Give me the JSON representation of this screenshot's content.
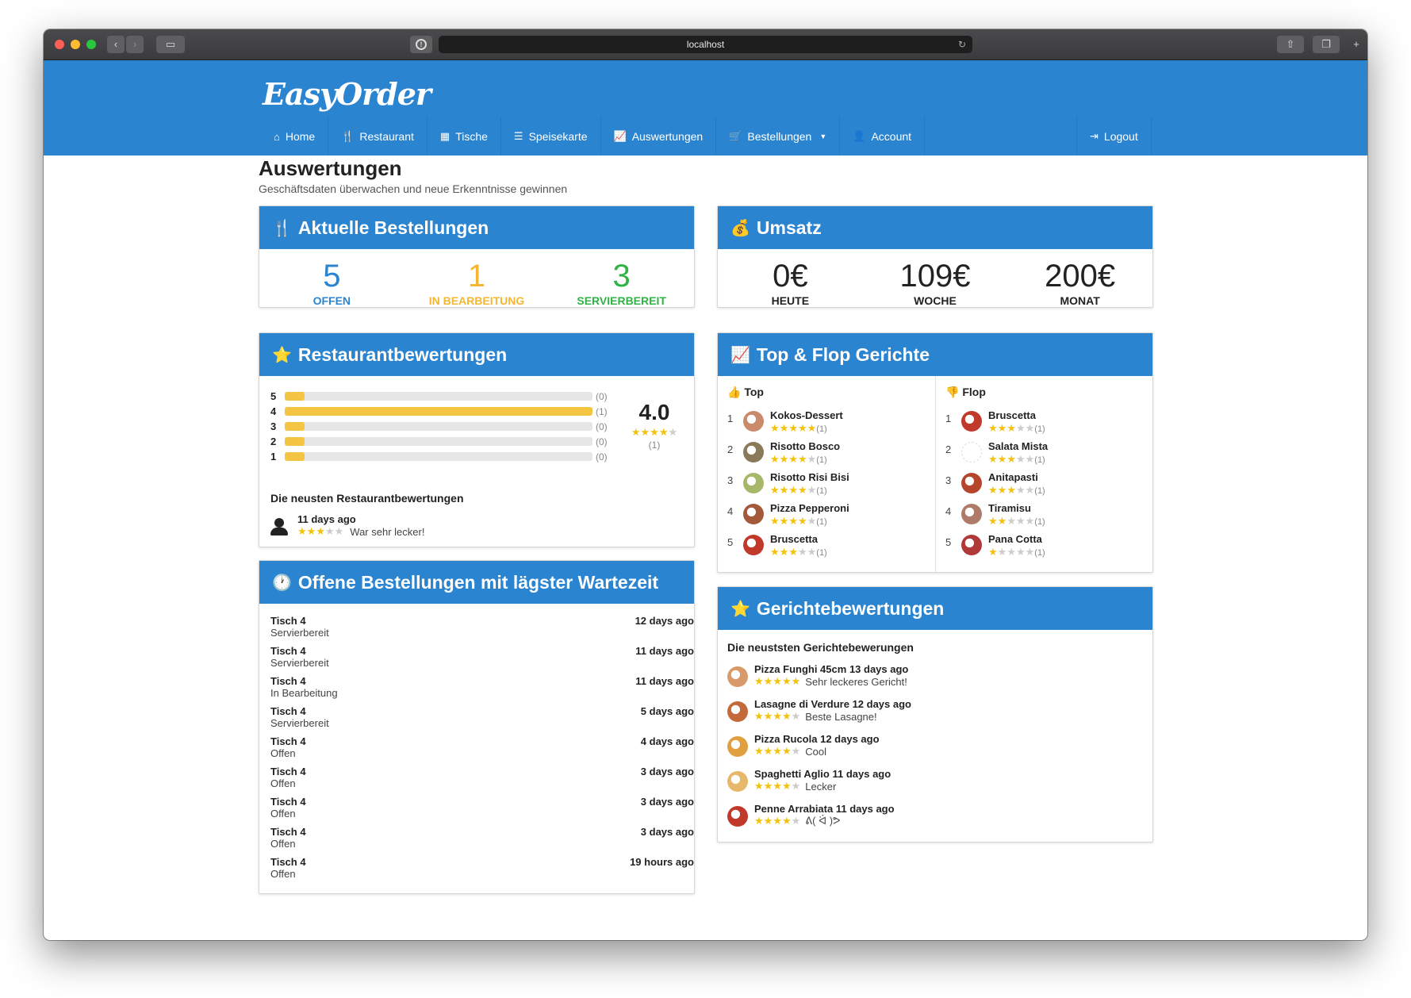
{
  "browser": {
    "url": "localhost"
  },
  "app": {
    "brand": "EasyOrder"
  },
  "nav": {
    "items": [
      {
        "label": "Home",
        "icon": "home-icon",
        "glyph": "⌂"
      },
      {
        "label": "Restaurant",
        "icon": "cutlery-icon",
        "glyph": "🍴"
      },
      {
        "label": "Tische",
        "icon": "grid-icon",
        "glyph": "▦"
      },
      {
        "label": "Speisekarte",
        "icon": "list-icon",
        "glyph": "☰"
      },
      {
        "label": "Auswertungen",
        "icon": "chart-icon",
        "glyph": "📈"
      },
      {
        "label": "Bestellungen",
        "icon": "cart-icon",
        "glyph": "🛒",
        "dropdown": true
      },
      {
        "label": "Account",
        "icon": "user-icon",
        "glyph": "👤"
      }
    ],
    "logout": {
      "label": "Logout",
      "icon": "logout-icon",
      "glyph": "⇥"
    }
  },
  "page": {
    "title": "Auswertungen",
    "subtitle": "Geschäftsdaten überwachen und neue Erkenntnisse gewinnen"
  },
  "orders": {
    "title": "Aktuelle Bestellungen",
    "icon": "🍴",
    "stats": [
      {
        "value": "5",
        "label": "OFFEN",
        "color": "#2a84d0"
      },
      {
        "value": "1",
        "label": "IN BEARBEITUNG",
        "color": "#f5b731"
      },
      {
        "value": "3",
        "label": "SERVIERBEREIT",
        "color": "#2fb344"
      }
    ]
  },
  "revenue": {
    "title": "Umsatz",
    "icon": "💰",
    "stats": [
      {
        "value": "0€",
        "label": "HEUTE"
      },
      {
        "value": "109€",
        "label": "WOCHE"
      },
      {
        "value": "200€",
        "label": "MONAT"
      }
    ]
  },
  "ratings": {
    "title": "Restaurantbewertungen",
    "icon": "⭐",
    "rows": [
      {
        "stars": "5",
        "count": "(0)",
        "fraction": 0.065
      },
      {
        "stars": "4",
        "count": "(1)",
        "fraction": 1.0
      },
      {
        "stars": "3",
        "count": "(0)",
        "fraction": 0.065
      },
      {
        "stars": "2",
        "count": "(0)",
        "fraction": 0.065
      },
      {
        "stars": "1",
        "count": "(0)",
        "fraction": 0.065
      }
    ],
    "average": "4.0",
    "average_stars": 4,
    "total": "(1)",
    "newest_title": "Die neusten Restaurantbewertungen",
    "newest": [
      {
        "when": "11 days ago",
        "stars": 3,
        "text": "War sehr lecker!"
      }
    ]
  },
  "waiting": {
    "title": "Offene Bestellungen mit lägster Wartezeit",
    "icon": "🕐",
    "rows": [
      {
        "table": "Tisch 4",
        "status": "Servierbereit",
        "ago": "12 days ago"
      },
      {
        "table": "Tisch 4",
        "status": "Servierbereit",
        "ago": "11 days ago"
      },
      {
        "table": "Tisch 4",
        "status": "In Bearbeitung",
        "ago": "11 days ago"
      },
      {
        "table": "Tisch 4",
        "status": "Servierbereit",
        "ago": "5 days ago"
      },
      {
        "table": "Tisch 4",
        "status": "Offen",
        "ago": "4 days ago"
      },
      {
        "table": "Tisch 4",
        "status": "Offen",
        "ago": "3 days ago"
      },
      {
        "table": "Tisch 4",
        "status": "Offen",
        "ago": "3 days ago"
      },
      {
        "table": "Tisch 4",
        "status": "Offen",
        "ago": "3 days ago"
      },
      {
        "table": "Tisch 4",
        "status": "Offen",
        "ago": "19 hours ago"
      }
    ]
  },
  "topflop": {
    "title": "Top & Flop Gerichte",
    "icon": "📈",
    "top": {
      "title": "Top",
      "icon": "👍",
      "items": [
        {
          "rank": "1",
          "name": "Kokos-Dessert",
          "stars": 5,
          "count": "(1)",
          "color": "#c98b6b"
        },
        {
          "rank": "2",
          "name": "Risotto Bosco",
          "stars": 4,
          "count": "(1)",
          "color": "#8a7a5a"
        },
        {
          "rank": "3",
          "name": "Risotto Risi Bisi",
          "stars": 4,
          "count": "(1)",
          "color": "#a8b86a"
        },
        {
          "rank": "4",
          "name": "Pizza Pepperoni",
          "stars": 4,
          "count": "(1)",
          "color": "#a45a3a"
        },
        {
          "rank": "5",
          "name": "Bruscetta",
          "stars": 3,
          "count": "(1)",
          "color": "#c0392b"
        }
      ]
    },
    "flop": {
      "title": "Flop",
      "icon": "👎",
      "items": [
        {
          "rank": "1",
          "name": "Bruscetta",
          "stars": 3,
          "count": "(1)",
          "color": "#c0392b"
        },
        {
          "rank": "2",
          "name": "Salata Mista",
          "stars": 3,
          "count": "(1)",
          "color": "#ffffff"
        },
        {
          "rank": "3",
          "name": "Anitapasti",
          "stars": 3,
          "count": "(1)",
          "color": "#b5452b"
        },
        {
          "rank": "4",
          "name": "Tiramisu",
          "stars": 2,
          "count": "(1)",
          "color": "#b07a6a"
        },
        {
          "rank": "5",
          "name": "Pana Cotta",
          "stars": 1,
          "count": "(1)",
          "color": "#b03a3a"
        }
      ]
    }
  },
  "dish_reviews": {
    "title": "Gerichtebewertungen",
    "icon": "⭐",
    "subtitle": "Die neuststen Gerichtebewerungen",
    "items": [
      {
        "dish": "Pizza Funghi 45cm",
        "when": "13 days ago",
        "stars": 5,
        "text": "Sehr leckeres Gericht!",
        "color": "#d89a6a"
      },
      {
        "dish": "Lasagne di Verdure",
        "when": "12 days ago",
        "stars": 4,
        "text": "Beste Lasagne!",
        "color": "#c46a3a"
      },
      {
        "dish": "Pizza Rucola",
        "when": "12 days ago",
        "stars": 4,
        "text": "Cool",
        "color": "#e0a040"
      },
      {
        "dish": "Spaghetti Aglio",
        "when": "11 days ago",
        "stars": 4,
        "text": "Lecker",
        "color": "#e8b86a"
      },
      {
        "dish": "Penne Arrabiata",
        "when": "11 days ago",
        "stars": 4,
        "text": "ᕕ( ᐛ )ᕗ",
        "color": "#c0392b"
      }
    ]
  }
}
